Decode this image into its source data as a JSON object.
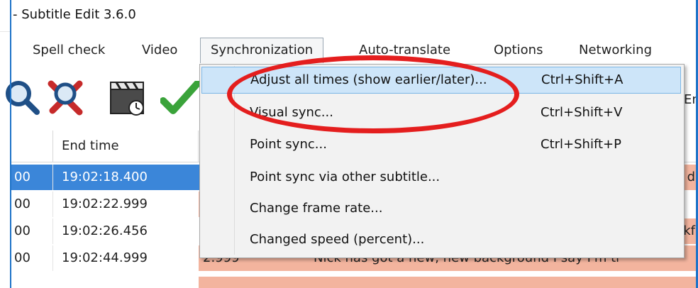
{
  "window": {
    "title": "- Subtitle Edit 3.6.0"
  },
  "menubar": {
    "items": [
      {
        "label": "Spell check"
      },
      {
        "label": "Video"
      },
      {
        "label": "Synchronization"
      },
      {
        "label": "Auto-translate"
      },
      {
        "label": "Options"
      },
      {
        "label": "Networking"
      }
    ]
  },
  "toolbar": {
    "icons": [
      "search-icon",
      "replace-icon",
      "video-clapper-icon",
      "checkmark-icon"
    ],
    "trailing_text": "En"
  },
  "grid": {
    "header_end_time": "End time",
    "rows": [
      {
        "start": "00",
        "end": "19:02:18.400",
        "duration": "",
        "text": "d",
        "selected": true
      },
      {
        "start": "00",
        "end": "19:02:22.999",
        "duration": "",
        "text": "",
        "selected": false
      },
      {
        "start": "00",
        "end": "19:02:26.456",
        "duration": "",
        "text": "kf",
        "selected": false
      },
      {
        "start": "00",
        "end": "19:02:44.999",
        "duration": "2.999",
        "text": "Nick has got a new, new background I say I'm tr",
        "selected": false
      }
    ]
  },
  "dropdown": {
    "items": [
      {
        "label": "Adjust all times (show earlier/later)...",
        "shortcut": "Ctrl+Shift+A"
      },
      {
        "label": "Visual sync...",
        "shortcut": "Ctrl+Shift+V"
      },
      {
        "label": "Point sync...",
        "shortcut": "Ctrl+Shift+P"
      },
      {
        "label": "Point sync via other subtitle...",
        "shortcut": ""
      },
      {
        "label": "Change frame rate...",
        "shortcut": ""
      },
      {
        "label": "Changed speed (percent)...",
        "shortcut": ""
      }
    ]
  },
  "colors": {
    "accent": "#3b86d9",
    "warning_row": "#f3b49e",
    "annotation": "#e41e1e",
    "menu_highlight": "#cde5f9"
  }
}
